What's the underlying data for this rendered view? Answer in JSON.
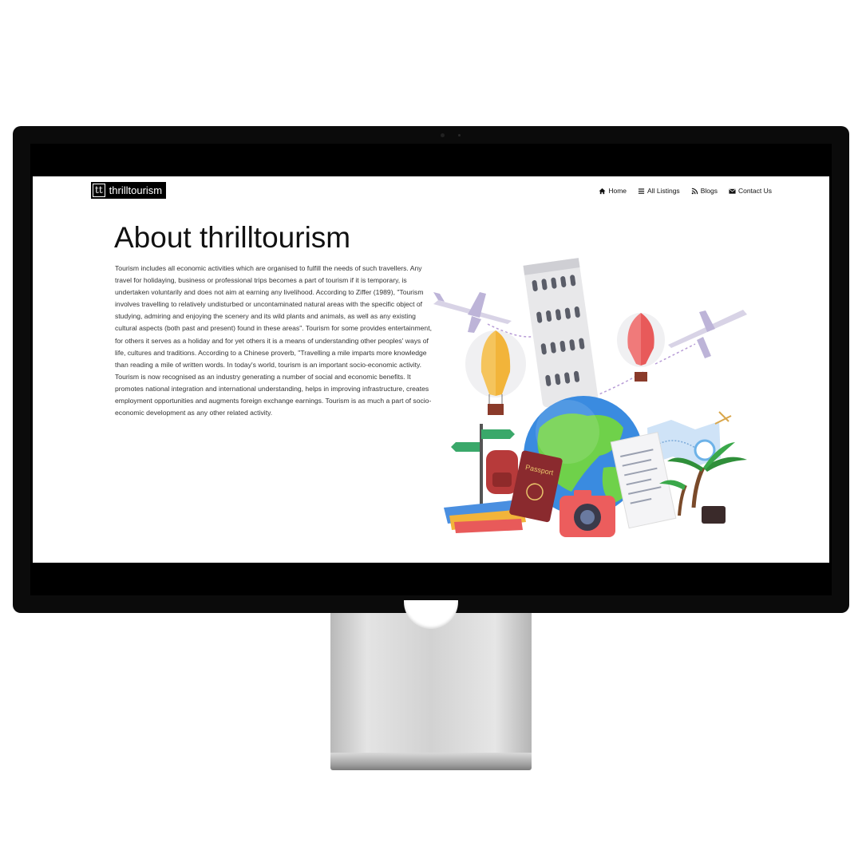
{
  "brand": {
    "logo_mark": "tt",
    "name": "thrilltourism"
  },
  "nav": {
    "items": [
      {
        "label": "Home",
        "icon": "home-icon"
      },
      {
        "label": "All Listings",
        "icon": "list-icon"
      },
      {
        "label": "Blogs",
        "icon": "rss-icon"
      },
      {
        "label": "Contact Us",
        "icon": "envelope-icon"
      }
    ]
  },
  "about": {
    "title": "About thrilltourism",
    "body": "Tourism includes all economic activities which are organised to fulfill the needs of such travellers. Any travel for holidaying, business or professional trips becomes a part of tourism if it is temporary, is undertaken voluntarily and does not aim at earning any livelihood. According to Ziffer (1989), \"Tourism involves travelling to relatively undisturbed or uncontaminated natural areas with the specific object of studying, admiring and enjoying the scenery and its wild plants and animals, as well as any existing cultural aspects (both past and present) found in these areas\". Tourism for some provides entertainment, for others it serves as a holiday and for yet others it is a means of understanding other peoples' ways of life, cultures and traditions. According to a Chinese proverb, \"Travelling a mile imparts more knowledge than reading a mile of written words. In today's world, tourism is an important socio-economic activity. Tourism is now recognised as an industry generating a number of social and economic benefits. It promotes national integration and international understanding, helps in improving infrastructure, creates employment opportunities and augments foreign exchange earnings. Tourism is as much a part of socio-economic development as any other related activity."
  },
  "illustration": {
    "passport_label": "Passport"
  }
}
